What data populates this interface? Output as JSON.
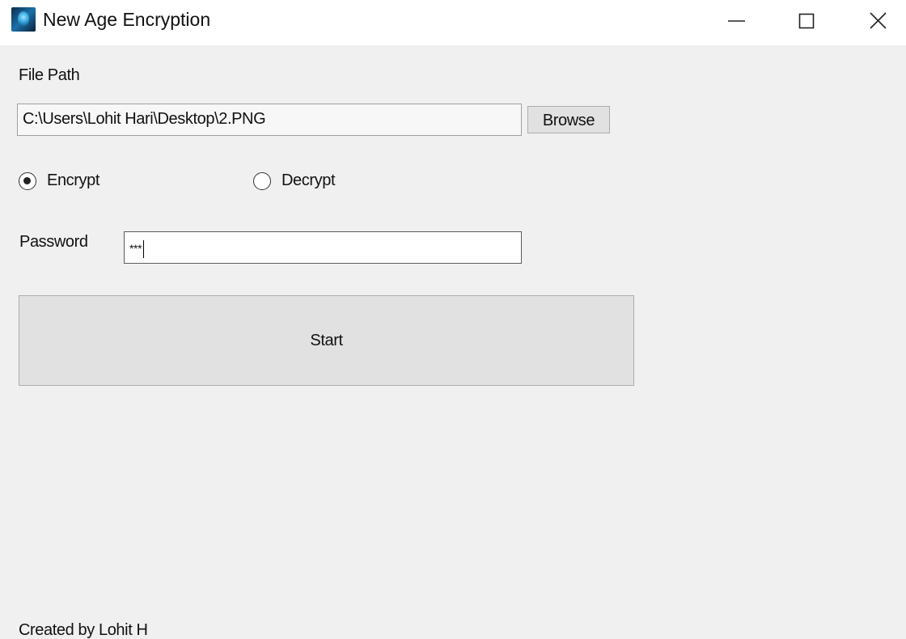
{
  "window": {
    "title": "New Age Encryption",
    "controls": {
      "minimize": "minimize",
      "maximize": "maximize",
      "close": "close"
    }
  },
  "form": {
    "file_path_label": "File Path",
    "file_path_value": "C:\\Users\\Lohit Hari\\Desktop\\2.PNG",
    "browse_label": "Browse",
    "mode_options": [
      {
        "label": "Encrypt",
        "selected": true
      },
      {
        "label": "Decrypt",
        "selected": false
      }
    ],
    "password_label": "Password",
    "password_masked": "***",
    "start_label": "Start"
  },
  "footer": {
    "credit": "Created by Lohit H"
  },
  "icons": {
    "app": "app-icon",
    "minimize": "minimize-icon",
    "maximize": "maximize-icon",
    "close": "close-icon"
  }
}
